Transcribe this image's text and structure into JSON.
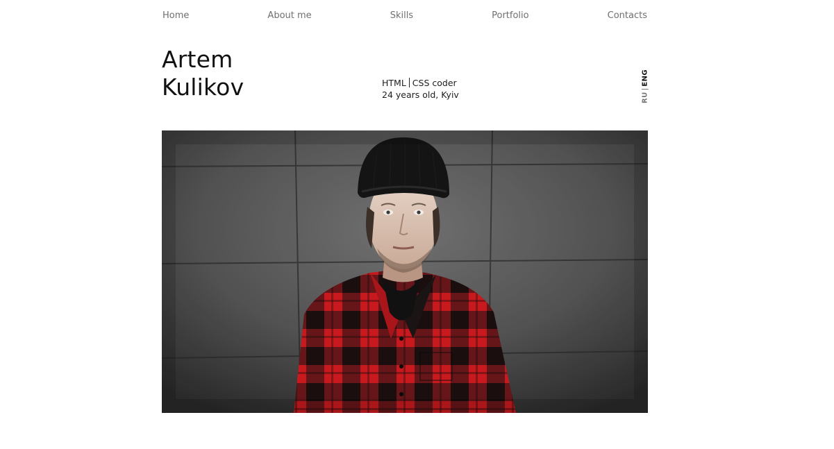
{
  "nav": {
    "items": [
      {
        "label": "Home"
      },
      {
        "label": "About me"
      },
      {
        "label": "Skills"
      },
      {
        "label": "Portfolio"
      },
      {
        "label": "Contacts"
      }
    ]
  },
  "hero": {
    "first_name": "Artem",
    "last_name": "Kulikov",
    "role_part1": "HTML",
    "role_part2": "CSS coder",
    "details": "24 years old, Kyiv"
  },
  "language": {
    "ru": "RU",
    "separator": "|",
    "eng": "ENG",
    "active": "ENG"
  },
  "colors": {
    "nav_text": "#6f6f6f",
    "heading": "#111111",
    "shirt_red": "#c81a1e",
    "wall": "#5a5a5a"
  }
}
